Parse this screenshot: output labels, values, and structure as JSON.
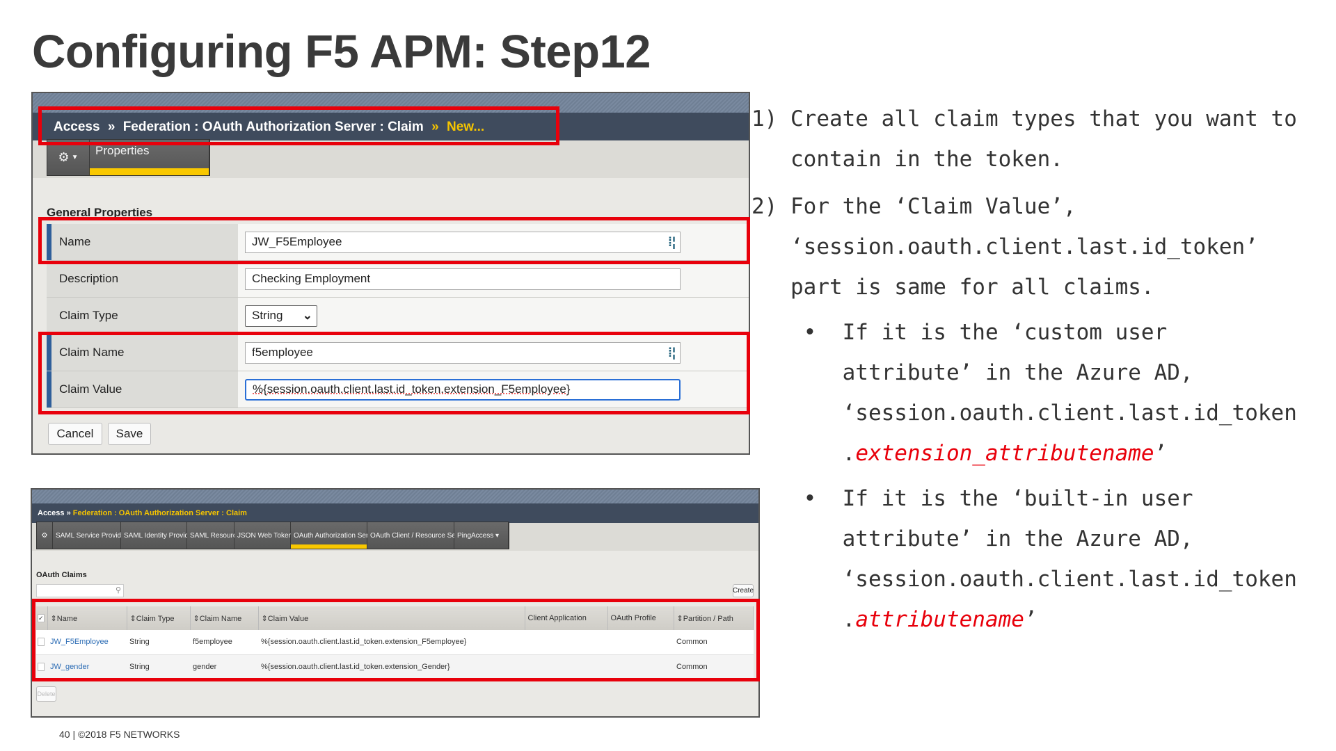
{
  "title": "Configuring F5 APM: Step12",
  "top_panel": {
    "breadcrumb": {
      "root": "Access",
      "sep": "»",
      "path": "Federation : OAuth Authorization Server : Claim",
      "current": "New..."
    },
    "tab": "Properties",
    "section": "General Properties",
    "fields": [
      {
        "label": "Name",
        "value": "JW_F5Employee"
      },
      {
        "label": "Description",
        "value": "Checking Employment"
      },
      {
        "label": "Claim Type",
        "value": "String"
      },
      {
        "label": "Claim Name",
        "value": "f5employee"
      },
      {
        "label": "Claim Value",
        "value": "%{session.oauth.client.last.id_token.extension_F5employee}"
      }
    ],
    "cancel": "Cancel",
    "save": "Save"
  },
  "bottom_panel": {
    "breadcrumb": {
      "root": "Access",
      "sep": "»",
      "path": "Federation : OAuth Authorization Server : Claim"
    },
    "tabs": [
      "SAML Service Provider ▾",
      "SAML Identity Provider ▾",
      "SAML Resources",
      "JSON Web Token ▾",
      "OAuth Authorization Server ▾",
      "OAuth Client / Resource Server ▾",
      "PingAccess ▾"
    ],
    "section": "OAuth Claims",
    "create": "Create",
    "delete": "Delete",
    "columns": [
      "Name",
      "Claim Type",
      "Claim Name",
      "Claim Value",
      "Client Application",
      "OAuth Profile",
      "Partition / Path"
    ],
    "rows": [
      {
        "name": "JW_F5Employee",
        "type": "String",
        "claim_name": "f5employee",
        "value": "%{session.oauth.client.last.id_token.extension_F5employee}",
        "client": "",
        "profile": "",
        "partition": "Common"
      },
      {
        "name": "JW_gender",
        "type": "String",
        "claim_name": "gender",
        "value": "%{session.oauth.client.last.id_token.extension_Gender}",
        "client": "",
        "profile": "",
        "partition": "Common"
      }
    ]
  },
  "steps": {
    "s1a": "1) Create all claim types that you want to",
    "s1b": "   contain in the token.",
    "s2a": "2) For the ‘Claim Value’,",
    "s2b": "   ‘session.oauth.client.last.id_token’",
    "s2c": "   part is same for all claims.",
    "b1a": "    •  If it is the ‘custom user",
    "b1b": "       attribute’ in the Azure AD,",
    "b1c": "       ‘session.oauth.client.last.id_token",
    "b1d_pre": "       .",
    "b1d_red": "extension_attributename",
    "b1d_post": "’",
    "b2a": "    •  If it is the ‘built-in user",
    "b2b": "       attribute’ in the Azure AD,",
    "b2c": "       ‘session.oauth.client.last.id_token",
    "b2d_pre": "       .",
    "b2d_red": "attributename",
    "b2d_post": "’"
  },
  "footer": "40 | ©2018 F5 NETWORKS",
  "colors": {
    "accent_red": "#e8000b",
    "tab_yellow": "#f9c800",
    "link": "#2d6db5"
  }
}
